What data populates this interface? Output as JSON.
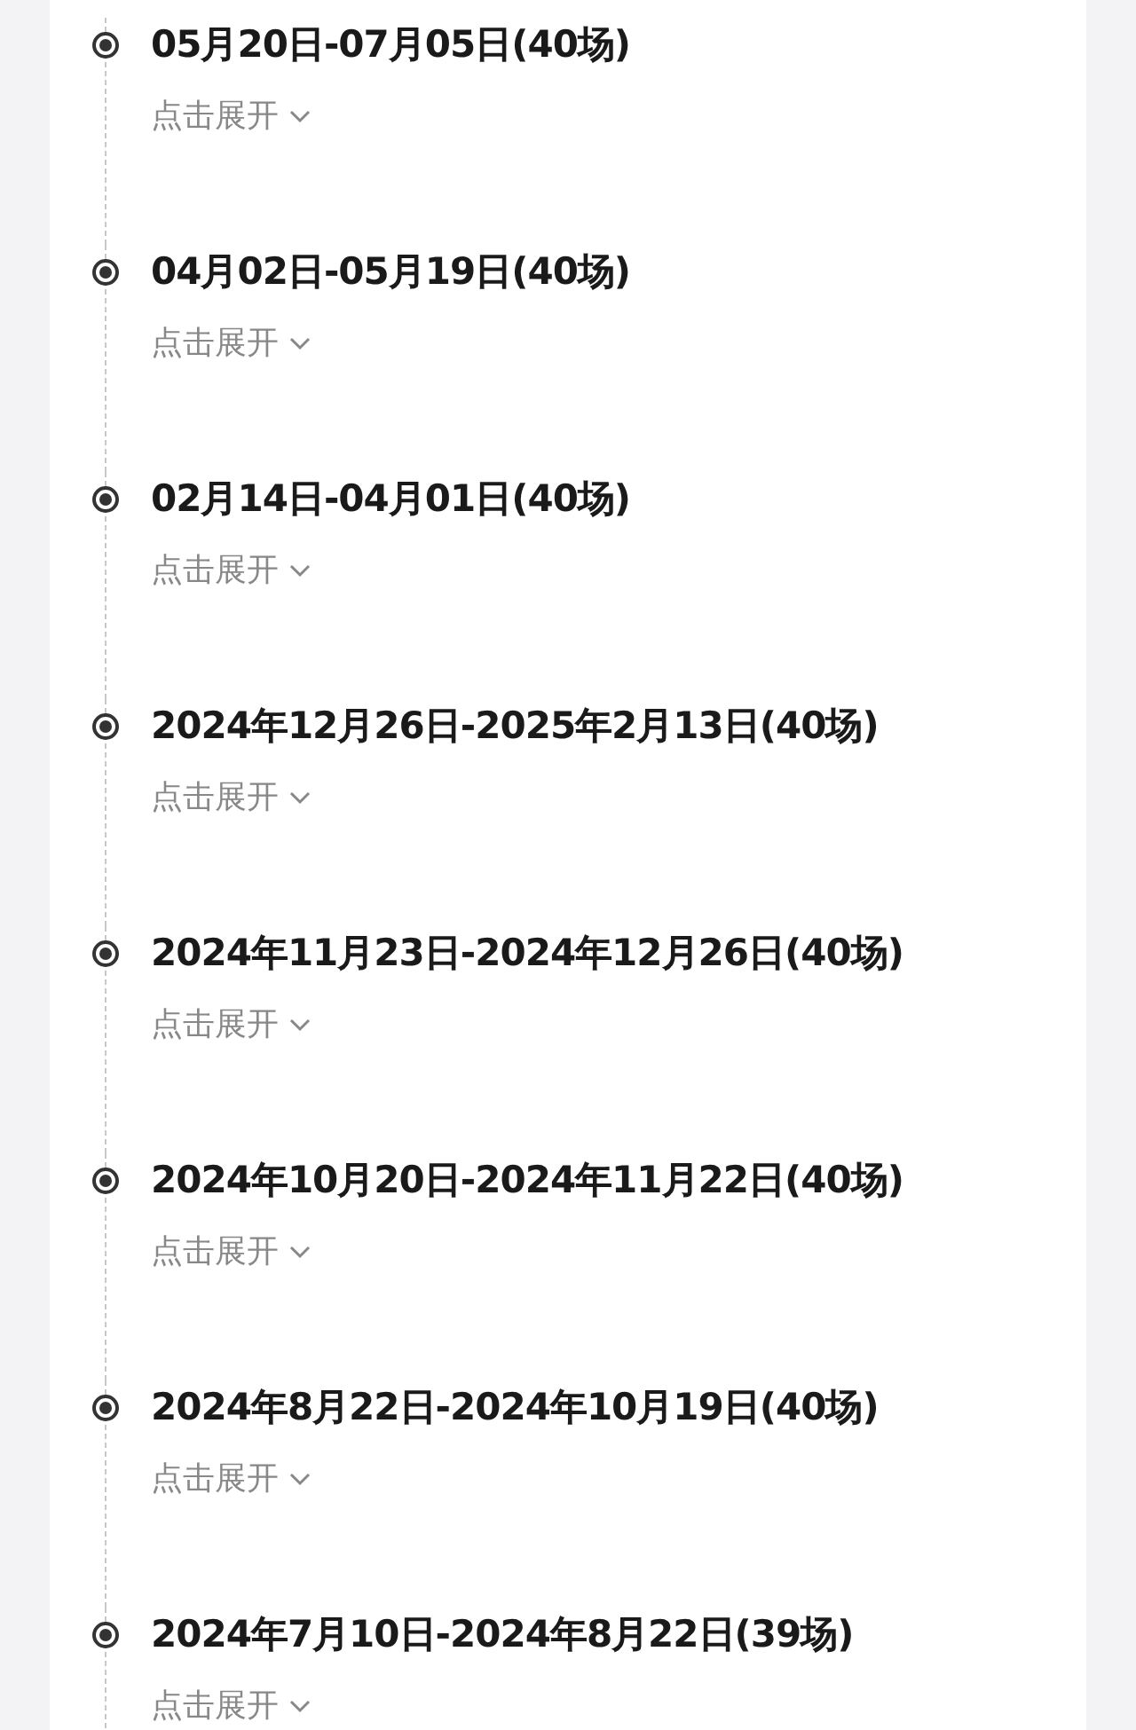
{
  "timeline": [
    {
      "title": "05月20日-07月05日(40场)",
      "action": "点击展开",
      "expanded": false
    },
    {
      "title": "04月02日-05月19日(40场)",
      "action": "点击展开",
      "expanded": false
    },
    {
      "title": "02月14日-04月01日(40场)",
      "action": "点击展开",
      "expanded": false
    },
    {
      "title": "2024年12月26日-2025年2月13日(40场)",
      "action": "点击展开",
      "expanded": false
    },
    {
      "title": "2024年11月23日-2024年12月26日(40场)",
      "action": "点击展开",
      "expanded": false
    },
    {
      "title": "2024年10月20日-2024年11月22日(40场)",
      "action": "点击展开",
      "expanded": false
    },
    {
      "title": "2024年8月22日-2024年10月19日(40场)",
      "action": "点击展开",
      "expanded": false
    },
    {
      "title": "2024年7月10日-2024年8月22日(39场)",
      "action": "点击展开",
      "expanded": false
    }
  ]
}
